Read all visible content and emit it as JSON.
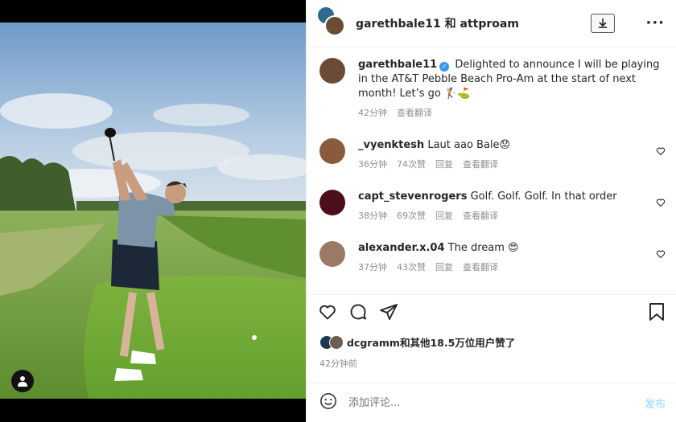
{
  "header": {
    "title": "garethbale11 和 attproam",
    "download_icon": "download-icon",
    "more_icon": "more-horizontal-icon",
    "more_glyph": "···"
  },
  "caption": {
    "username": "garethbale11",
    "verified": true,
    "text": "Delighted to announce I will be playing in the AT&T Pebble Beach Pro-Am at the start of next month! Let’s go 🏌️⛳",
    "time": "42分钟",
    "translate": "查看翻译"
  },
  "comments": [
    {
      "username": "_vyenktesh",
      "text": "Laut aao Bale😟",
      "time": "36分钟",
      "likes": "74次赞",
      "reply": "回复",
      "translate": "查看翻译"
    },
    {
      "username": "capt_stevenrogers",
      "text": "Golf. Golf. Golf. In that order",
      "time": "38分钟",
      "likes": "69次赞",
      "reply": "回复",
      "translate": "查看翻译"
    },
    {
      "username": "alexander.x.04",
      "text": "The dream 😍",
      "time": "37分钟",
      "likes": "43次赞",
      "reply": "回复",
      "translate": "查看翻译"
    }
  ],
  "actions": {
    "icons": [
      "heart-icon",
      "comment-icon",
      "share-icon",
      "bookmark-icon"
    ]
  },
  "likes_text": "dcgramm和其他18.5万位用户赞了",
  "post_time": "42分钟前",
  "comment_box": {
    "placeholder": "添加评论...",
    "post_label": "发布"
  },
  "colors": {
    "link": "#0095f6",
    "muted": "#8e8e8e",
    "post_disabled": "#b2dffc"
  }
}
